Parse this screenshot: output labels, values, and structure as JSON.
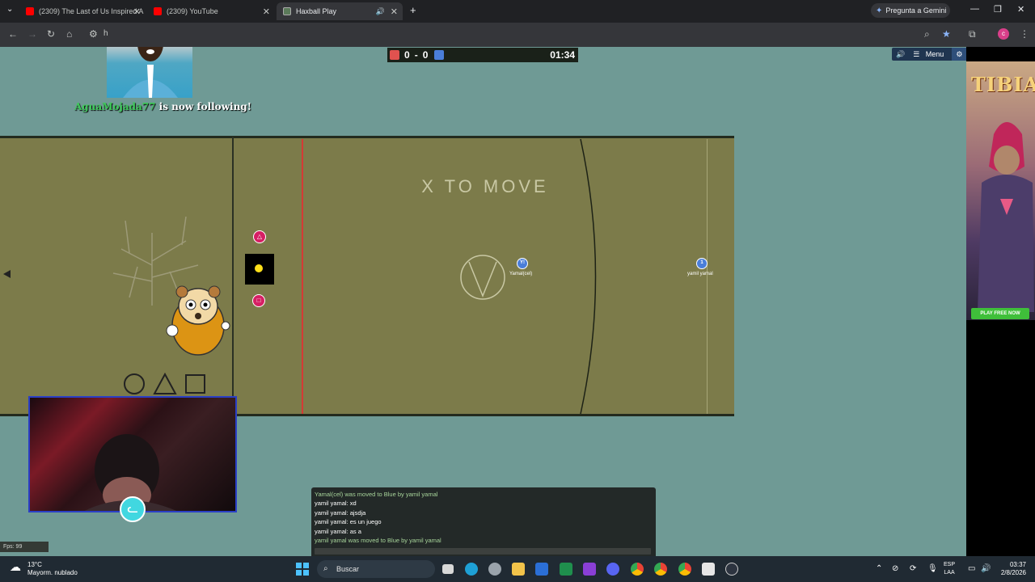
{
  "browser": {
    "tabs": [
      {
        "title": "(2309) The Last of Us Inspired A",
        "active": false
      },
      {
        "title": "(2309) YouTube",
        "active": false
      },
      {
        "title": "Haxball Play",
        "active": true
      }
    ],
    "new_tab_icon": "+",
    "gemini_label": "Pregunta a Gemini",
    "address_fragment": "h",
    "profile_initial": "c",
    "colors": {
      "youtube": "#ff0000",
      "chrome_dark": "#202124"
    }
  },
  "game": {
    "score_red": "0",
    "score_sep": "-",
    "score_blue": "0",
    "timer": "01:34",
    "menu_label": "Menu",
    "field_text": "X TO MOVE",
    "players": [
      {
        "avatar": "Y!",
        "name": "Yamal(cel)"
      },
      {
        "avatar": "1",
        "name": "yamil yamal"
      }
    ],
    "colors": {
      "red_team": "#e0524f",
      "blue_team": "#4a7ed9",
      "field": "#7c7b4a"
    }
  },
  "stream": {
    "follower_name": "AguaMojada77",
    "follow_text": "is now following!"
  },
  "ad": {
    "logo": "TIBIA",
    "button": "PLAY FREE NOW"
  },
  "chat": {
    "lines": [
      {
        "text": "Yamal(cel) was moved to Blue by yamil yamal",
        "notice": true
      },
      {
        "text": "yamil yamal: xd",
        "notice": false
      },
      {
        "text": "yamil yamal: ajsdja",
        "notice": false
      },
      {
        "text": "yamil yamal: es un juego",
        "notice": false
      },
      {
        "text": "yamil yamal: as a",
        "notice": false
      },
      {
        "text": "yamil yamal was moved to Blue by yamil yamal",
        "notice": true
      }
    ]
  },
  "fps": "Fps: 99",
  "taskbar": {
    "temperature": "13°C",
    "weather": "Mayorm. nublado",
    "search_placeholder": "Buscar",
    "lang_1": "ESP",
    "lang_2": "LAA",
    "time": "03:37",
    "date": "2/8/2026"
  }
}
